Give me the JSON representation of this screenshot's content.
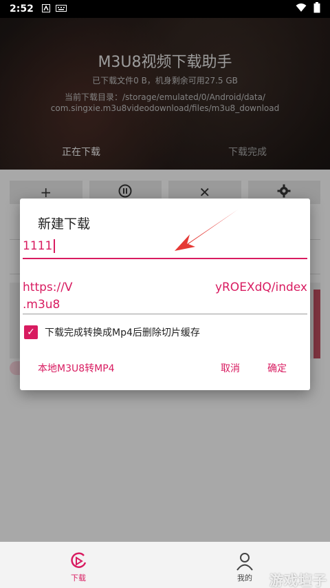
{
  "status_bar": {
    "time": "2:52",
    "icons": [
      "notification-a-icon",
      "keyboard-icon",
      "wifi-icon",
      "battery-icon"
    ]
  },
  "header": {
    "title": "M3U8视频下载助手",
    "downloaded_info": "已下载文件0 B，机身剩余可用27.5 GB",
    "dir_line1": "当前下载目录：/storage/emulated/0/Android/data/",
    "dir_line2": "com.singxie.m3u8videodownload/files/m3u8_download",
    "tabs": [
      {
        "label": "正在下载",
        "active": true
      },
      {
        "label": "下载完成",
        "active": false
      }
    ]
  },
  "toolbar": {
    "buttons": [
      "add-icon",
      "pause-icon",
      "close-icon",
      "gear-icon"
    ],
    "add_glyph": "+",
    "close_glyph": "✕"
  },
  "dialog": {
    "title": "新建下载",
    "name_value": "1111",
    "url_left": "https://V",
    "url_right": "yROEXdQ/index",
    "url_line2": ".m3u8",
    "checkbox_label": "下载完成转换成Mp4后删除切片缓存",
    "checkbox_checked": true,
    "btn_local": "本地M3U8转MP4",
    "btn_cancel": "取消",
    "btn_ok": "确定"
  },
  "bottom_nav": {
    "items": [
      {
        "label": "下载",
        "icon": "download-play-icon",
        "active": true
      },
      {
        "label": "我的",
        "icon": "user-icon",
        "active": false
      }
    ]
  },
  "watermark": "游戏壇子",
  "colors": {
    "accent": "#d81b60",
    "arrow": "#e53935"
  }
}
